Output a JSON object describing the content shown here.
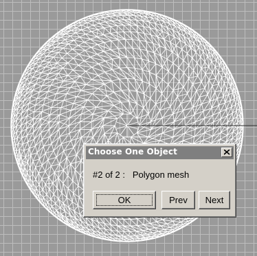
{
  "viewport": {
    "background_color": "#9a9a9a",
    "grid_color": "#bdbdbd",
    "mesh_color": "#ffffff",
    "axis_color": "#333333"
  },
  "dialog": {
    "title": "Choose One Object",
    "close_icon": "close-icon",
    "message": "#2 of 2 :   Polygon mesh",
    "ok_label": "OK",
    "prev_label": "Prev",
    "next_label": "Next"
  }
}
